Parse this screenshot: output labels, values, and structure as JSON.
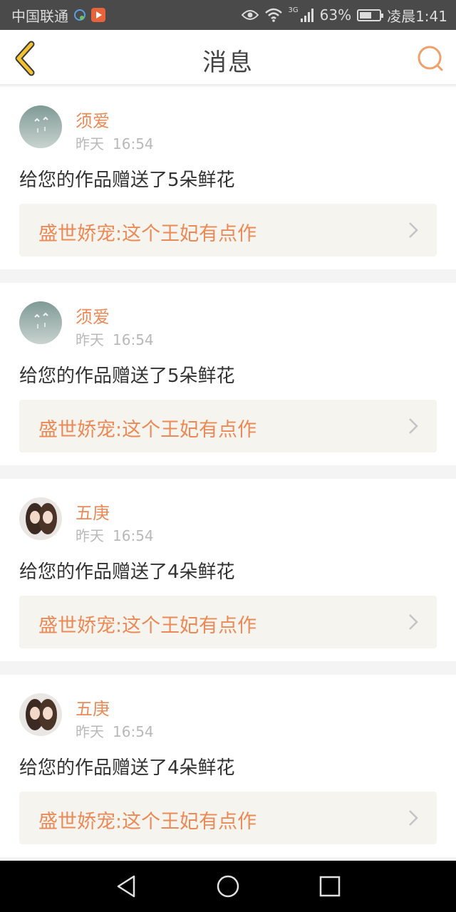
{
  "status_bar": {
    "carrier": "中国联通",
    "network_type": "3G",
    "battery": "63%",
    "battery_level": 0.63,
    "time": "凌晨1:41"
  },
  "header": {
    "title": "消息",
    "back_icon": "chevron-left-icon",
    "search_icon": "search-icon",
    "accent_color": "#f0a06a"
  },
  "messages": [
    {
      "user": "须爱",
      "date": "昨天",
      "time": "16:54",
      "text": "给您的作品赠送了5朵鲜花",
      "work": "盛世娇宠:这个王妃有点作",
      "avatar": "sky-avatar"
    },
    {
      "user": "须爱",
      "date": "昨天",
      "time": "16:54",
      "text": "给您的作品赠送了5朵鲜花",
      "work": "盛世娇宠:这个王妃有点作",
      "avatar": "sky-avatar"
    },
    {
      "user": "五庚",
      "date": "昨天",
      "time": "16:54",
      "text": "给您的作品赠送了4朵鲜花",
      "work": "盛世娇宠:这个王妃有点作",
      "avatar": "portrait-avatar"
    },
    {
      "user": "五庚",
      "date": "昨天",
      "time": "16:54",
      "text": "给您的作品赠送了4朵鲜花",
      "work": "盛世娇宠:这个王妃有点作",
      "avatar": "portrait-avatar"
    }
  ],
  "colors": {
    "name": "#ec8a57",
    "link_bg": "#f5f4ee",
    "time": "#b9b9b9"
  },
  "nav_bar": {
    "back_icon": "triangle-back-icon",
    "home_icon": "circle-home-icon",
    "recents_icon": "square-recents-icon"
  }
}
